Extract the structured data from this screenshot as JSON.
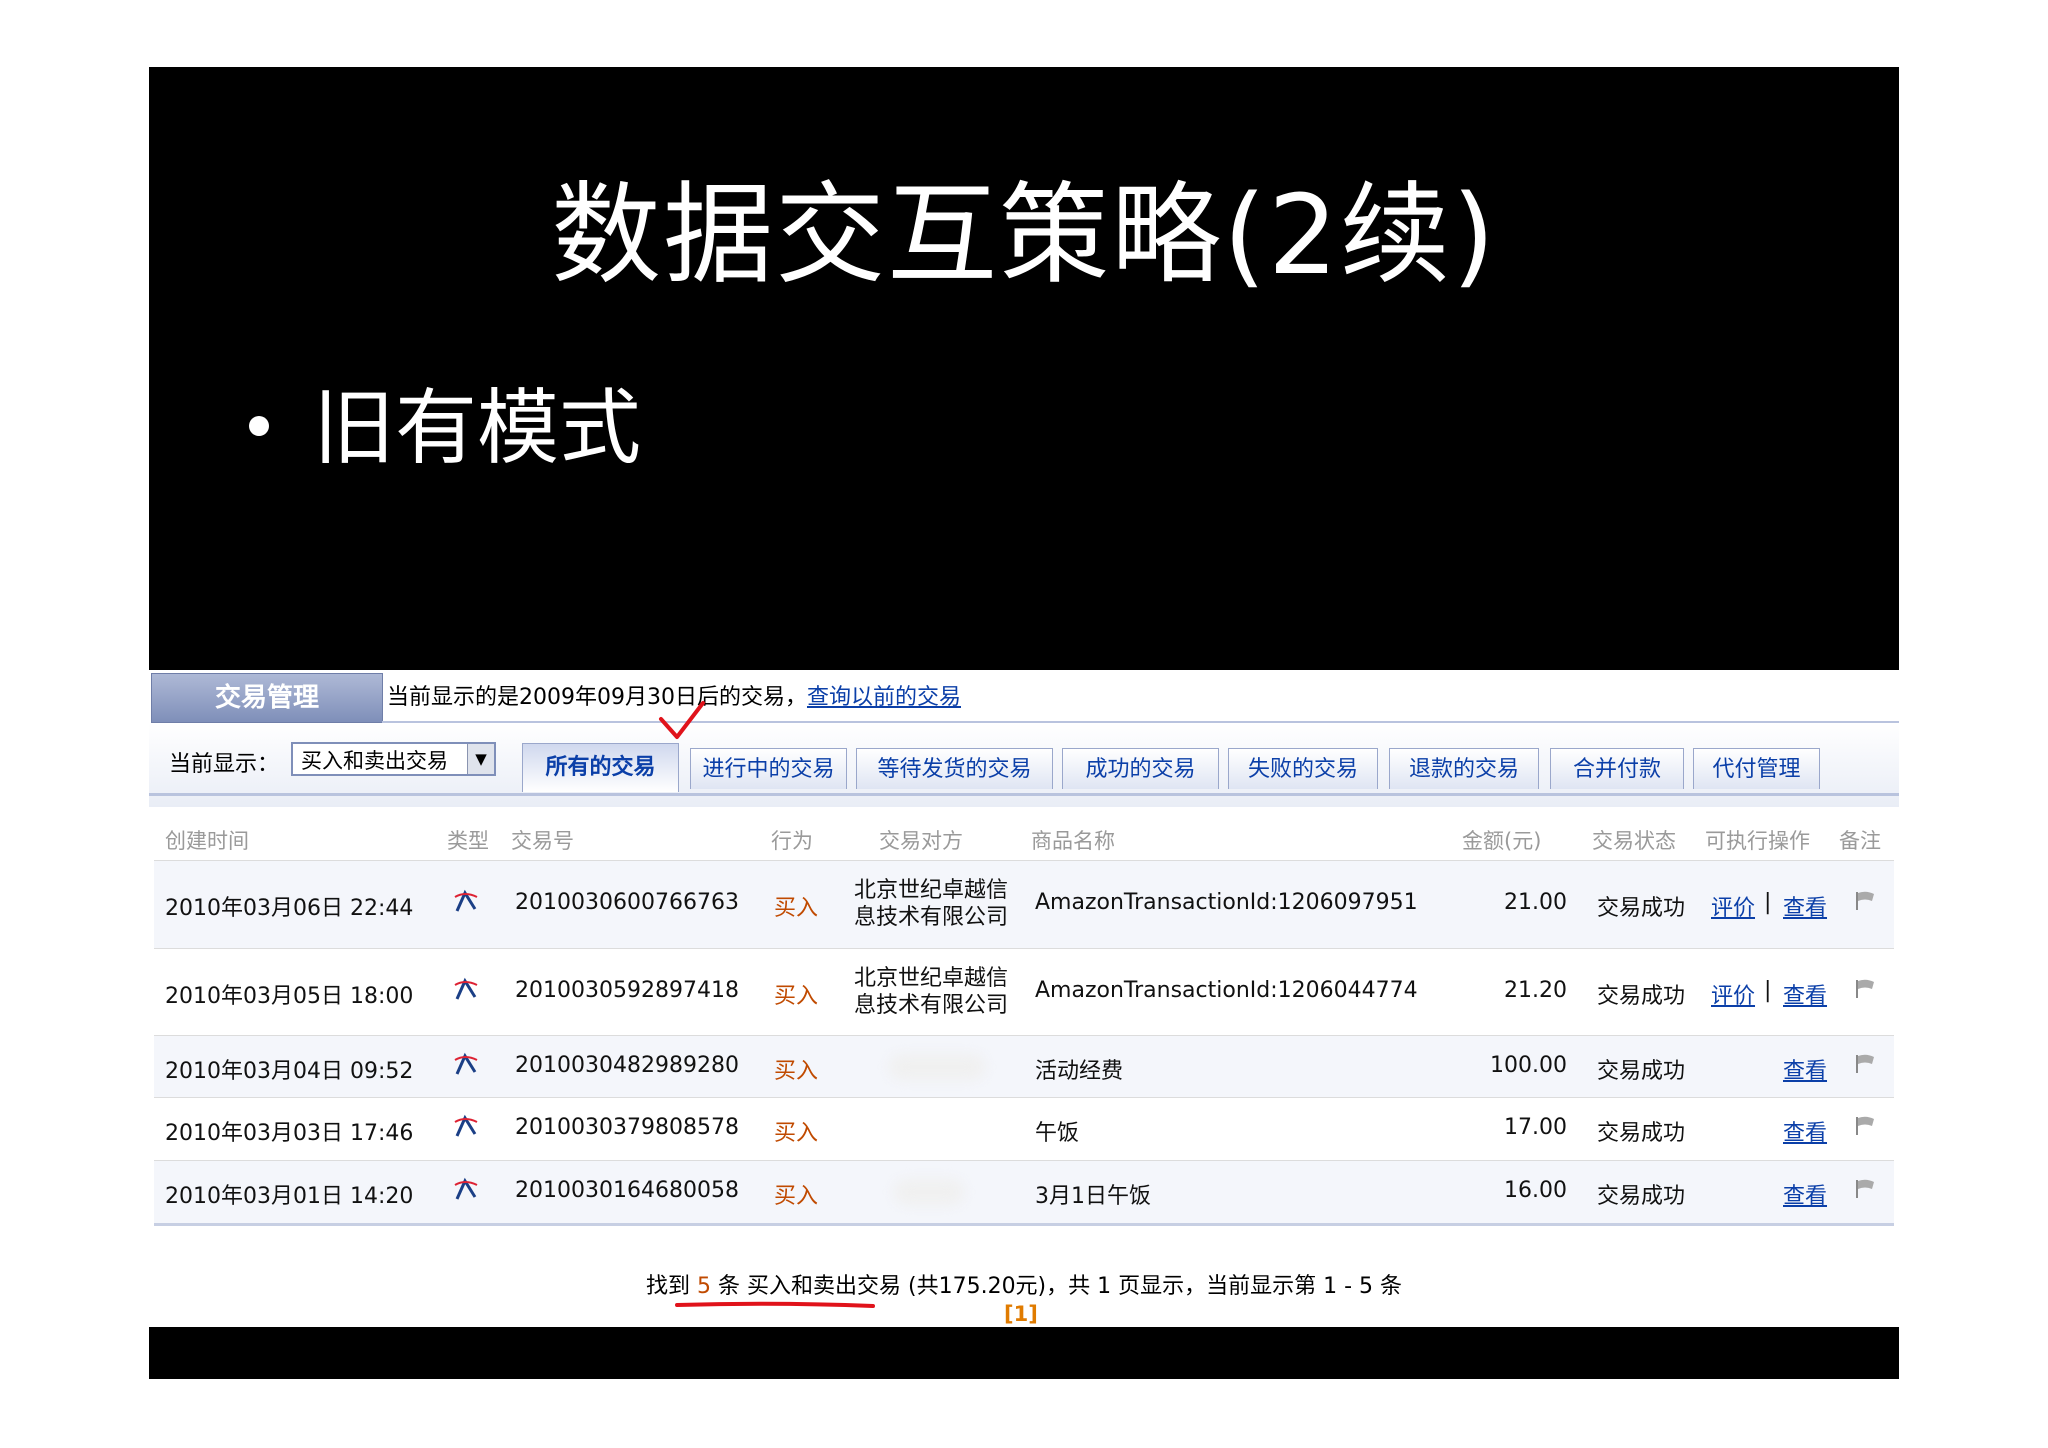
{
  "slide": {
    "title": "数据交互策略(2续)",
    "bullet": "旧有模式"
  },
  "screenshot": {
    "header": {
      "tab_label": "交易管理",
      "info_text": "当前显示的是2009年09月30日后的交易，",
      "query_link": "查询以前的交易"
    },
    "filter": {
      "label": "当前显示：",
      "selected": "买入和卖出交易"
    },
    "tabs": [
      {
        "label": "所有的交易",
        "active": true
      },
      {
        "label": "进行中的交易"
      },
      {
        "label": "等待发货的交易"
      },
      {
        "label": "成功的交易"
      },
      {
        "label": "失败的交易"
      },
      {
        "label": "退款的交易"
      },
      {
        "label": "合并付款"
      },
      {
        "label": "代付管理"
      }
    ],
    "columns": [
      "创建时间",
      "类型",
      "交易号",
      "行为",
      "交易对方",
      "商品名称",
      "金额(元)",
      "交易状态",
      "可执行操作",
      "备注"
    ],
    "rows": [
      {
        "time": "2010年03月06日 22:44",
        "trade_no": "2010030600766763",
        "action": "买入",
        "counterpart_1": "北京世纪卓越信",
        "counterpart_2": "息技术有限公司",
        "item": "AmazonTransactionId:1206097951",
        "amount": "21.00",
        "status": "交易成功",
        "op_rate": "评价",
        "op_sep": "|",
        "op_view": "查看"
      },
      {
        "time": "2010年03月05日 18:00",
        "trade_no": "2010030592897418",
        "action": "买入",
        "counterpart_1": "北京世纪卓越信",
        "counterpart_2": "息技术有限公司",
        "item": "AmazonTransactionId:1206044774",
        "amount": "21.20",
        "status": "交易成功",
        "op_rate": "评价",
        "op_sep": "|",
        "op_view": "查看"
      },
      {
        "time": "2010年03月04日 09:52",
        "trade_no": "2010030482989280",
        "action": "买入",
        "item": "活动经费",
        "amount": "100.00",
        "status": "交易成功",
        "op_view": "查看"
      },
      {
        "time": "2010年03月03日 17:46",
        "trade_no": "2010030379808578",
        "action": "买入",
        "item": "午饭",
        "amount": "17.00",
        "status": "交易成功",
        "op_view": "查看"
      },
      {
        "time": "2010年03月01日 14:20",
        "trade_no": "2010030164680058",
        "action": "买入",
        "item": "3月1日午饭",
        "amount": "16.00",
        "status": "交易成功",
        "op_view": "查看"
      }
    ],
    "summary": {
      "prefix": "找到",
      "count": "5",
      "unit": "条",
      "kind": "买入和卖出交易",
      "total": "(共175.20元)",
      "rest": "，共 1 页显示，当前显示第 1 - 5 条"
    },
    "pager": "[1]"
  },
  "colors": {
    "link": "#0b3fa8",
    "buy": "#c04a00",
    "pager": "#e07b00",
    "mark": "#e0131b"
  }
}
